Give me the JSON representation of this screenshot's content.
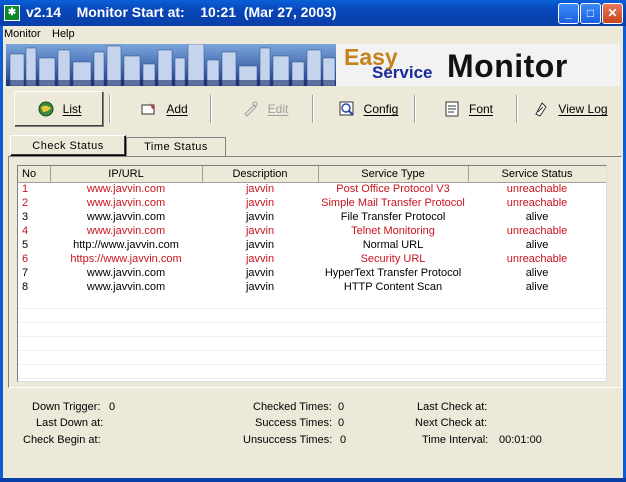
{
  "window": {
    "title": "v2.14    Monitor Start at:    10:21  (Mar 27, 2003)",
    "app_icon": "app-icon",
    "controls": [
      "minimize-icon",
      "maximize-icon",
      "close-icon"
    ]
  },
  "menu": {
    "items": [
      "Monitor",
      "Help"
    ]
  },
  "banner": {
    "easy": "Easy",
    "service": "Service",
    "monitor": "Monitor"
  },
  "toolbar": {
    "list": "List",
    "add": "Add",
    "edit": "Edit",
    "config": "Config",
    "font": "Font",
    "viewlog": "View Log"
  },
  "tabs": {
    "check_status": "Check  Status",
    "time_status": "Time  Status"
  },
  "table": {
    "columns": [
      "No",
      "IP/URL",
      "Description",
      "Service Type",
      "Service Status"
    ],
    "rows": [
      {
        "no": "1",
        "url": "www.javvin.com",
        "desc": "javvin",
        "type": "Post Office Protocol V3",
        "status": "unreachable",
        "state": "down"
      },
      {
        "no": "2",
        "url": "www.javvin.com",
        "desc": "javvin",
        "type": "Simple Mail Transfer Protocol",
        "status": "unreachable",
        "state": "down"
      },
      {
        "no": "3",
        "url": "www.javvin.com",
        "desc": "javvin",
        "type": "File Transfer Protocol",
        "status": "alive",
        "state": "up"
      },
      {
        "no": "4",
        "url": "www.javvin.com",
        "desc": "javvin",
        "type": "Telnet Monitoring",
        "status": "unreachable",
        "state": "down"
      },
      {
        "no": "5",
        "url": "http://www.javvin.com",
        "desc": "javvin",
        "type": "Normal URL",
        "status": "alive",
        "state": "up"
      },
      {
        "no": "6",
        "url": "https://www.javvin.com",
        "desc": "javvin",
        "type": "Security URL",
        "status": "unreachable",
        "state": "down"
      },
      {
        "no": "7",
        "url": "www.javvin.com",
        "desc": "javvin",
        "type": "HyperText Transfer Protocol",
        "status": "alive",
        "state": "up"
      },
      {
        "no": "8",
        "url": "www.javvin.com",
        "desc": "javvin",
        "type": "HTTP Content Scan",
        "status": "alive",
        "state": "up"
      }
    ]
  },
  "status": {
    "down_trigger_label": "Down Trigger:",
    "down_trigger_value": "0",
    "last_down_label": "Last Down at:",
    "check_begin_label": "Check Begin at:",
    "checked_times_label": "Checked Times:",
    "checked_times_value": "0",
    "success_times_label": "Success Times:",
    "success_times_value": "0",
    "unsuccess_times_label": "Unsuccess Times:",
    "unsuccess_times_value": "0",
    "last_check_label": "Last Check at:",
    "next_check_label": "Next Check at:",
    "time_interval_label": "Time Interval:",
    "time_interval_value": "00:01:00"
  },
  "colors": {
    "down": "#c8141e",
    "up": "#000000",
    "titlebar": "#0a5fd8"
  }
}
